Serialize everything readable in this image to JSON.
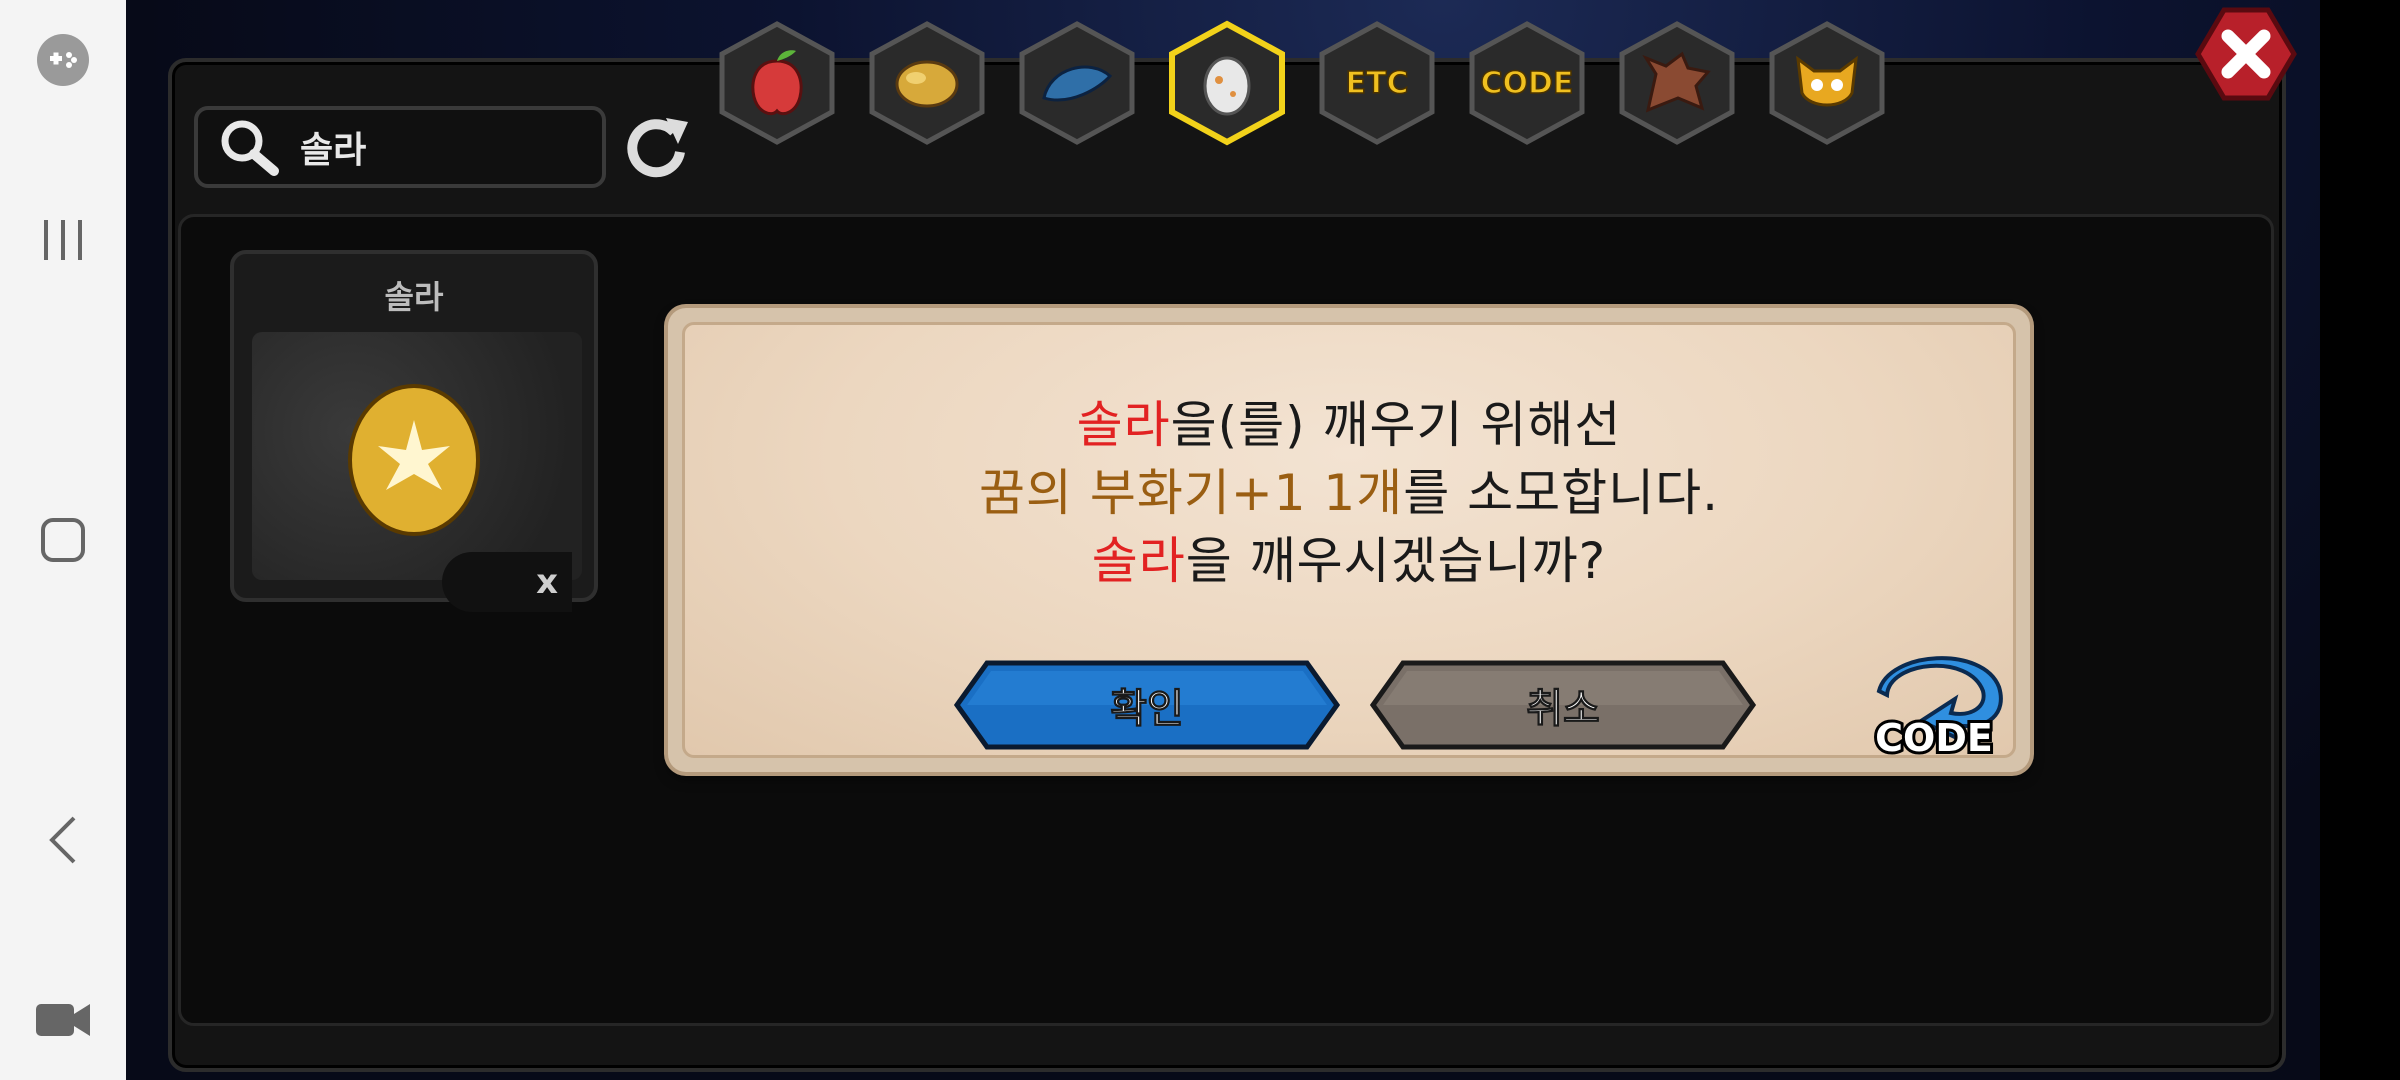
{
  "system_nav": {
    "items": [
      {
        "name": "game-launcher",
        "icon": "gamepad-icon"
      },
      {
        "name": "recents",
        "icon": "recents-icon"
      },
      {
        "name": "home",
        "icon": "home-icon"
      },
      {
        "name": "back",
        "icon": "back-icon"
      },
      {
        "name": "screen-recorder",
        "icon": "video-camera-icon"
      }
    ]
  },
  "search": {
    "value": "솔라",
    "icon": "search-icon"
  },
  "refresh": {
    "icon": "refresh-icon"
  },
  "tabs": [
    {
      "name": "fruit",
      "icon": "fruit-icon"
    },
    {
      "name": "food",
      "icon": "food-icon"
    },
    {
      "name": "dragon-scale",
      "icon": "scale-icon"
    },
    {
      "name": "egg",
      "icon": "egg-icon",
      "selected": true
    },
    {
      "name": "etc",
      "label": "ETC"
    },
    {
      "name": "code",
      "label": "CODE"
    },
    {
      "name": "dragon",
      "icon": "dragon-head-icon"
    },
    {
      "name": "mask",
      "icon": "mask-icon"
    }
  ],
  "close": {
    "icon": "close-icon"
  },
  "item_card": {
    "title": "솔라",
    "quantity_prefix": "x",
    "icon": "golden-egg-icon"
  },
  "dialog": {
    "line1": {
      "name": "솔라",
      "text": "을(를) 깨우기 위해선"
    },
    "line2": {
      "item": "꿈의 부화기+1 1개",
      "text": "를 소모합니다."
    },
    "line3": {
      "name": "솔라",
      "text": "을 깨우시겠습니까?"
    },
    "confirm_label": "확인",
    "cancel_label": "취소",
    "code_label": "CODE"
  },
  "colors": {
    "name_red": "#e22222",
    "item_gold": "#9a5e12",
    "confirm_blue": "#1a6fc4",
    "cancel_gray": "#7a7068",
    "tab_gold": "#f0c020"
  }
}
